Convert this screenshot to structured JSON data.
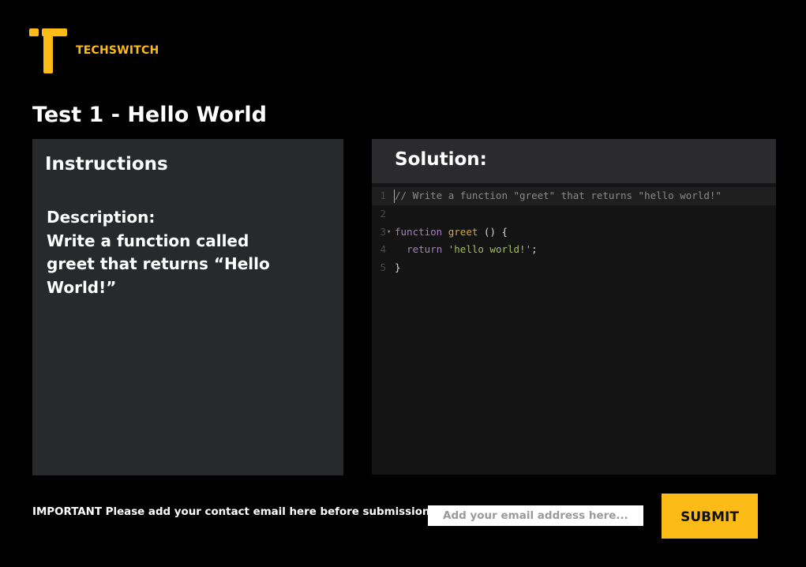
{
  "brand": {
    "name": "TECHSWITCH",
    "logo_icon": "techswitch-t-icon",
    "accent_color": "#fdbb17"
  },
  "page": {
    "title": "Test 1 - Hello World"
  },
  "instructions": {
    "heading": "Instructions",
    "description_label": "Description:",
    "description_text": "Write a function called greet that returns “Hello World!”"
  },
  "solution": {
    "heading": "Solution:",
    "editor": {
      "lines": [
        {
          "number": "1",
          "comment": "// Write a function \"greet\" that returns \"hello world!\""
        },
        {
          "number": "2"
        },
        {
          "number": "3",
          "fold": "▾",
          "keyword": "function",
          "name": "greet",
          "rest": " () {"
        },
        {
          "number": "4",
          "indent": "  ",
          "keyword": "return",
          "string": "'hello world!'",
          "rest": ";"
        },
        {
          "number": "5",
          "rest": "}"
        }
      ]
    }
  },
  "footer": {
    "email_label": "IMPORTANT Please add your contact email here before submission:",
    "email_placeholder": "Add your email address here...",
    "email_value": "",
    "submit_label": "SUBMIT"
  }
}
